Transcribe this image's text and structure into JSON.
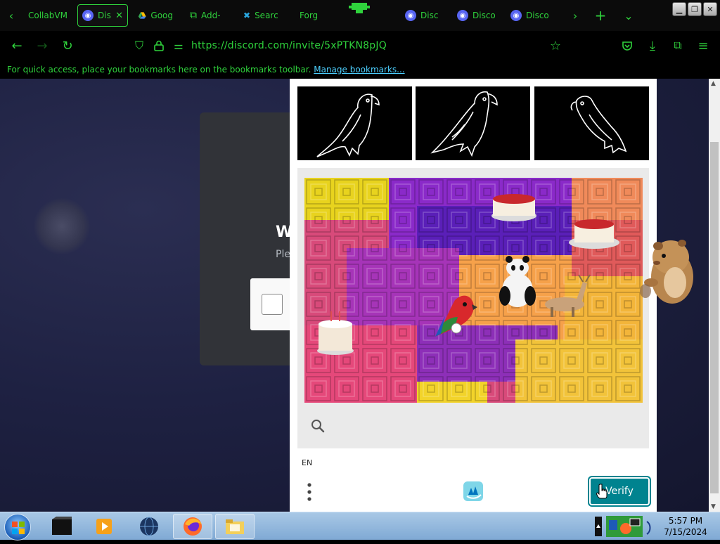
{
  "browser": {
    "tabs": [
      {
        "label": "CollabVM",
        "icon": "green-monitor-icon",
        "active": false
      },
      {
        "label": "Dis",
        "icon": "discord-icon",
        "active": true
      },
      {
        "label": "Goog",
        "icon": "google-drive-icon",
        "active": false
      },
      {
        "label": "Add-",
        "icon": "puzzle-icon",
        "active": false
      },
      {
        "label": "Searc",
        "icon": "blue-x-icon",
        "active": false
      },
      {
        "label": "Forg",
        "icon": "alien-icon",
        "active": false
      },
      {
        "label": "Disc",
        "icon": "discord-icon",
        "active": false
      },
      {
        "label": "Disco",
        "icon": "discord-icon",
        "active": false
      },
      {
        "label": "Disco",
        "icon": "discord-icon",
        "active": false
      }
    ],
    "url": "https://discord.com/invite/5xPTKN8pJQ",
    "bookmarks_message": "For quick access, place your bookmarks here on the bookmarks toolbar.",
    "bookmarks_link": "Manage bookmarks...",
    "accent_color": "#2fd23c"
  },
  "discord_page": {
    "heading_fragment": "W",
    "subtext_fragment": "Ple"
  },
  "captcha": {
    "example_images": [
      "parrot-outline-1",
      "parrot-outline-2",
      "parrot-outline-3"
    ],
    "challenge_objects": [
      "cake",
      "cake",
      "cake",
      "panda",
      "deer",
      "parrot"
    ],
    "language": "EN",
    "verify_label": "Verify",
    "verify_color": "#00838f"
  },
  "taskbar": {
    "time": "5:57 PM",
    "date": "7/15/2024",
    "items": [
      "terminal-icon",
      "media-player-icon",
      "globe-icon",
      "firefox-icon",
      "file-manager-icon"
    ]
  }
}
